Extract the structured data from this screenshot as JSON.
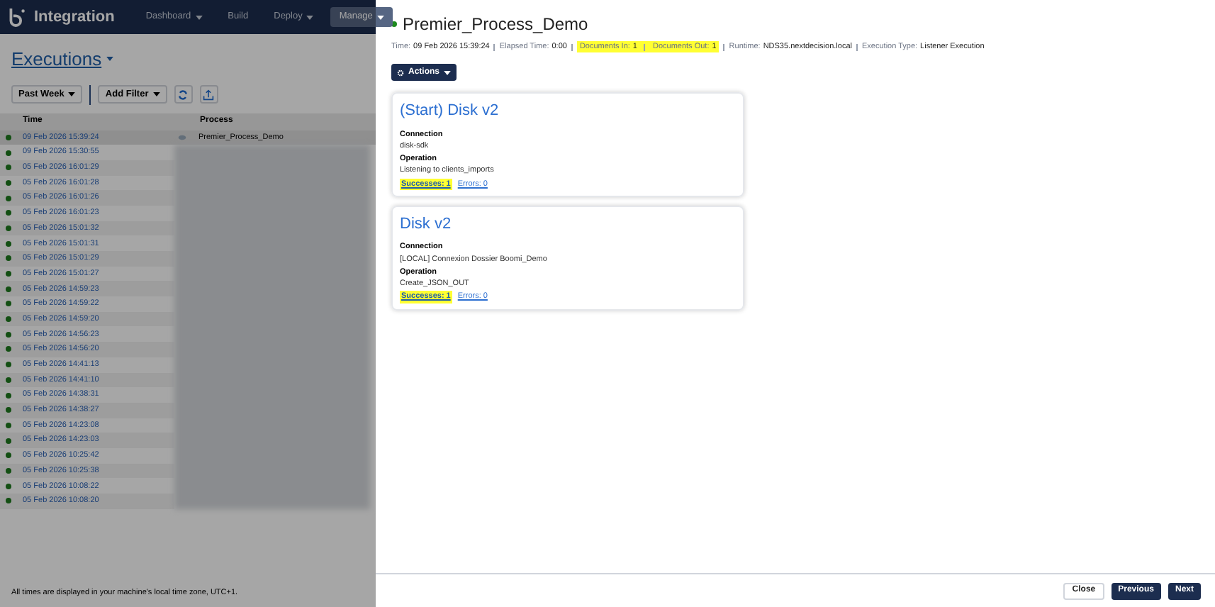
{
  "app": {
    "name": "Integration",
    "nav": [
      {
        "label": "Dashboard",
        "dropdown": true,
        "selected": false
      },
      {
        "label": "Build",
        "dropdown": false,
        "selected": false
      },
      {
        "label": "Deploy",
        "dropdown": true,
        "selected": false
      },
      {
        "label": "Manage",
        "dropdown": true,
        "selected": true
      }
    ]
  },
  "list": {
    "title": "Executions",
    "period": "Past Week",
    "filter": "Add Filter",
    "columns": [
      "Time",
      "Process"
    ],
    "rows": [
      {
        "time": "09 Feb 2026 15:39:24",
        "process": "Premier_Process_Demo",
        "selected": true
      },
      {
        "time": "09 Feb 2026 15:30:55",
        "selected": false
      },
      {
        "time": "05 Feb 2026 16:01:29",
        "selected": false
      },
      {
        "time": "05 Feb 2026 16:01:28",
        "selected": false
      },
      {
        "time": "05 Feb 2026 16:01:26",
        "selected": false
      },
      {
        "time": "05 Feb 2026 16:01:23",
        "selected": false
      },
      {
        "time": "05 Feb 2026 15:01:32",
        "selected": false
      },
      {
        "time": "05 Feb 2026 15:01:31",
        "selected": false
      },
      {
        "time": "05 Feb 2026 15:01:29",
        "selected": false
      },
      {
        "time": "05 Feb 2026 15:01:27",
        "selected": false
      },
      {
        "time": "05 Feb 2026 14:59:23",
        "selected": false
      },
      {
        "time": "05 Feb 2026 14:59:22",
        "selected": false
      },
      {
        "time": "05 Feb 2026 14:59:20",
        "selected": false
      },
      {
        "time": "05 Feb 2026 14:56:23",
        "selected": false
      },
      {
        "time": "05 Feb 2026 14:56:20",
        "selected": false
      },
      {
        "time": "05 Feb 2026 14:41:13",
        "selected": false
      },
      {
        "time": "05 Feb 2026 14:41:10",
        "selected": false
      },
      {
        "time": "05 Feb 2026 14:38:31",
        "selected": false
      },
      {
        "time": "05 Feb 2026 14:38:27",
        "selected": false
      },
      {
        "time": "05 Feb 2026 14:23:08",
        "selected": false
      },
      {
        "time": "05 Feb 2026 14:23:03",
        "selected": false
      },
      {
        "time": "05 Feb 2026 10:25:42",
        "selected": false
      },
      {
        "time": "05 Feb 2026 10:25:38",
        "selected": false
      },
      {
        "time": "05 Feb 2026 10:08:22",
        "selected": false
      },
      {
        "time": "05 Feb 2026 10:08:20",
        "selected": false
      }
    ],
    "footnote": "All times are displayed in your machine's local time zone, UTC+1."
  },
  "detail": {
    "title": "Premier_Process_Demo",
    "meta": [
      {
        "label": "Time:",
        "value": "09 Feb 2026 15:39:24",
        "highlighted": false
      },
      {
        "label": "Elapsed Time:",
        "value": "0:00",
        "highlighted": false
      },
      {
        "label": "Documents In:",
        "value": "1",
        "highlighted": true
      },
      {
        "label": "Documents Out:",
        "value": "1",
        "highlighted": true
      },
      {
        "label": "Runtime:",
        "value": "NDS35.nextdecision.local",
        "highlighted": false
      },
      {
        "label": "Execution Type:",
        "value": "Listener Execution",
        "highlighted": false
      }
    ],
    "actions": "Actions",
    "cards": [
      {
        "title": "(Start) Disk v2",
        "connection_label": "Connection",
        "connection": "disk-sdk",
        "operation_label": "Operation",
        "operation": "Listening to clients_imports",
        "successes": "Successes: 1",
        "successes_highlighted": true,
        "errors": "Errors: 0"
      },
      {
        "title": "Disk v2",
        "connection_label": "Connection",
        "connection": "[LOCAL] Connexion Dossier Boomi_Demo",
        "operation_label": "Operation",
        "operation": "Create_JSON_OUT",
        "successes": "Successes: 1",
        "successes_highlighted": true,
        "errors": "Errors: 0"
      }
    ],
    "buttons": [
      {
        "label": "Close",
        "kind": "secondary"
      },
      {
        "label": "Previous",
        "kind": "primary"
      },
      {
        "label": "Next",
        "kind": "primary"
      }
    ]
  }
}
